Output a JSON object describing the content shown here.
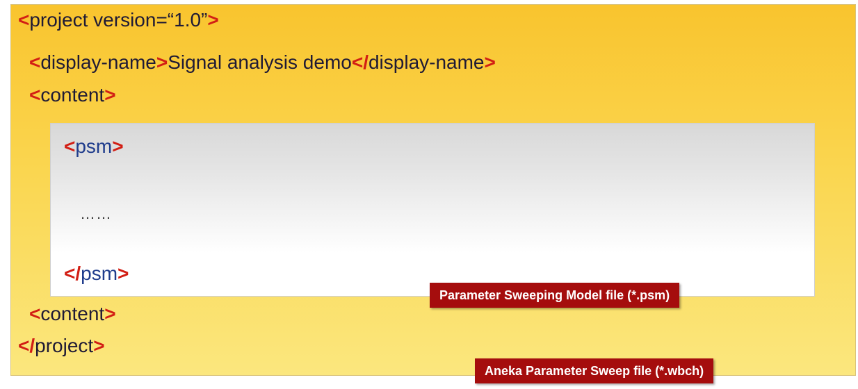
{
  "lines": {
    "project_open": {
      "lt": "<",
      "name": "project version=“1.0”",
      "gt": ">"
    },
    "display_name": {
      "lt1": "<",
      "open_name": "display-name",
      "gt1": ">",
      "text": "Signal analysis demo",
      "lt2": "</",
      "close_name": "display-name",
      "gt2": ">"
    },
    "content_open": {
      "lt": "<",
      "name": "content",
      "gt": ">"
    },
    "psm_open": {
      "lt": "<",
      "name": "psm",
      "gt": ">"
    },
    "ellipsis": "……",
    "psm_close": {
      "lt": "</",
      "name": "psm",
      "gt": ">"
    },
    "content_close": {
      "lt": "<",
      "name": "content",
      "gt": ">"
    },
    "project_close": {
      "lt": "</",
      "name": "project",
      "gt": ">"
    }
  },
  "labels": {
    "psm_file": "Parameter Sweeping Model file (*.psm)",
    "wbch_file": "Aneka Parameter Sweep file (*.wbch)"
  },
  "colors": {
    "bracket": "#d21e14",
    "badge_bg": "#a50d0d",
    "panel_top": "#f9c42e",
    "panel_bottom": "#fbe77e"
  }
}
